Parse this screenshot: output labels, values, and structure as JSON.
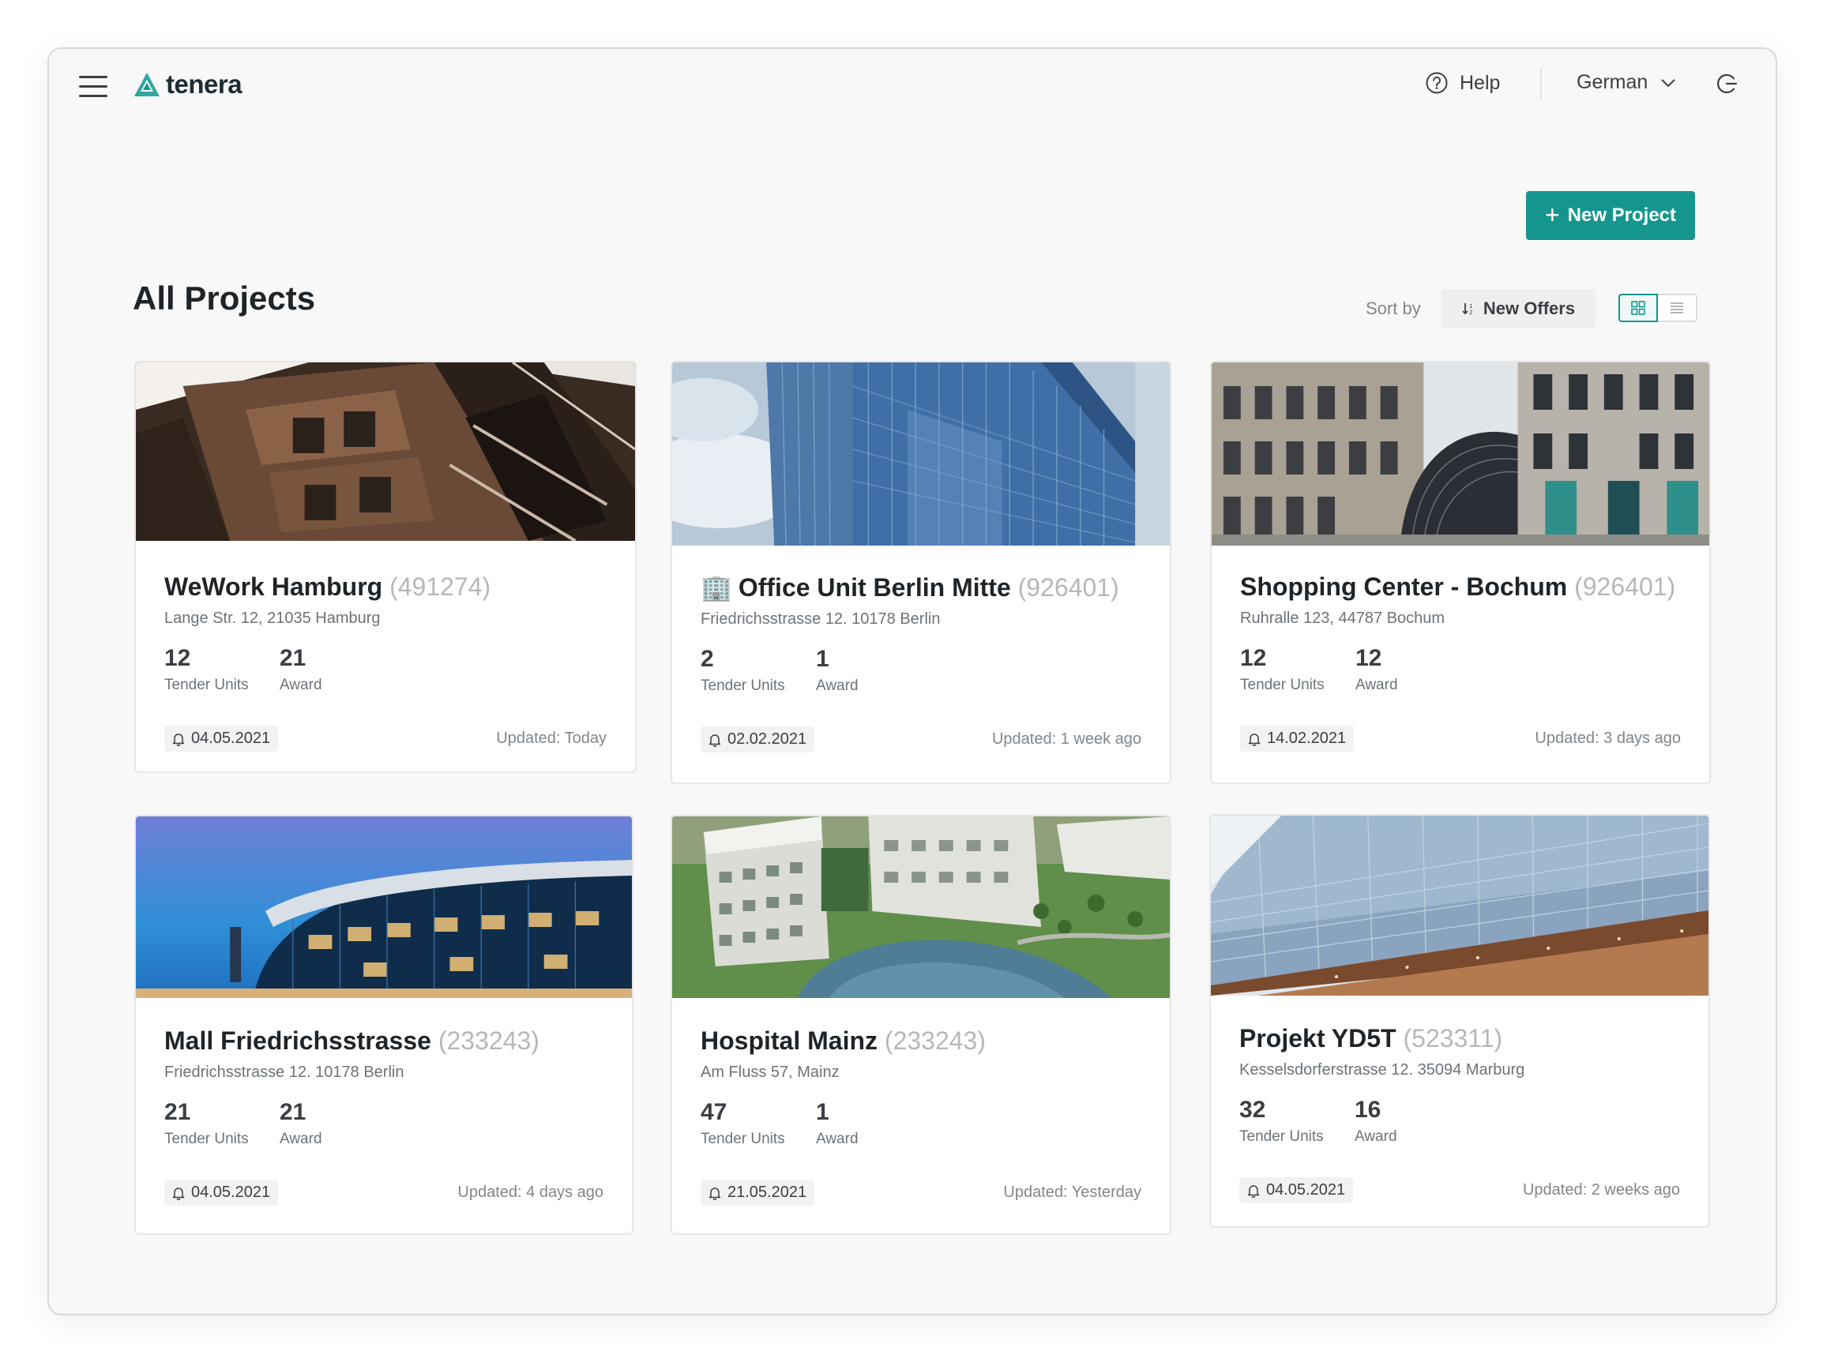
{
  "app": {
    "brand": "tenera",
    "accent_color": "#14968f"
  },
  "header": {
    "help_label": "Help",
    "language_label": "German",
    "icons": [
      "hamburger-menu-icon",
      "help-circle-icon",
      "chevron-down-icon",
      "logout-icon"
    ]
  },
  "toolbar": {
    "new_project_label": "New Project",
    "page_title": "All Projects",
    "sort_label": "Sort by",
    "sort_value": "New Offers",
    "view_mode": "grid"
  },
  "stat_labels": {
    "tender_units": "Tender Units",
    "award": "Award"
  },
  "cards": [
    {
      "emoji": "",
      "title": "WeWork Hamburg",
      "id": "(491274)",
      "address": "Lange Str. 12, 21035 Hamburg",
      "tender_units": "12",
      "award": "21",
      "date": "04.05.2021",
      "updated": "Updated: Today"
    },
    {
      "emoji": "🏢",
      "title": "Office Unit Berlin Mitte",
      "id": "(926401)",
      "address": "Friedrichsstrasse 12. 10178 Berlin",
      "tender_units": "2",
      "award": "1",
      "date": "02.02.2021",
      "updated": "Updated: 1 week ago"
    },
    {
      "emoji": "",
      "title": "Shopping Center - Bochum",
      "id": "(926401)",
      "address": "Ruhralle 123,  44787 Bochum",
      "tender_units": "12",
      "award": "12",
      "date": "14.02.2021",
      "updated": "Updated: 3 days ago"
    },
    {
      "emoji": "",
      "title": "Mall Friedrichsstrasse",
      "id": "(233243)",
      "address": "Friedrichsstrasse 12. 10178 Berlin",
      "tender_units": "21",
      "award": "21",
      "date": "04.05.2021",
      "updated": "Updated: 4 days ago"
    },
    {
      "emoji": "",
      "title": "Hospital Mainz",
      "id": "(233243)",
      "address": "Am Fluss 57, Mainz",
      "tender_units": "47",
      "award": "1",
      "date": "21.05.2021",
      "updated": "Updated: Yesterday"
    },
    {
      "emoji": "",
      "title": "Projekt YD5T",
      "id": "(523311)",
      "address": "Kesselsdorferstrasse 12. 35094 Marburg",
      "tender_units": "32",
      "award": "16",
      "date": "04.05.2021",
      "updated": "Updated: 2 weeks ago"
    }
  ]
}
